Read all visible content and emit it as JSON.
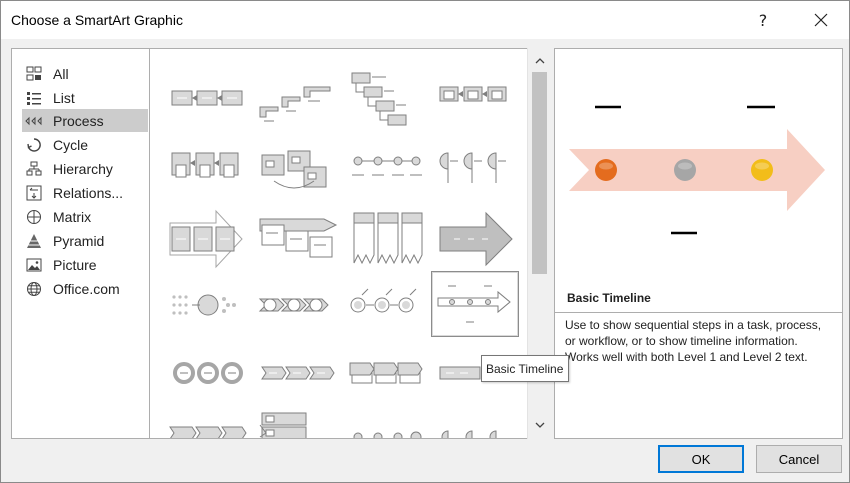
{
  "window": {
    "title": "Choose a SmartArt Graphic",
    "help": "?",
    "close": "✕"
  },
  "categories": [
    {
      "label": "All",
      "icon": "all-icon"
    },
    {
      "label": "List",
      "icon": "list-icon"
    },
    {
      "label": "Process",
      "icon": "process-icon",
      "selected": true
    },
    {
      "label": "Cycle",
      "icon": "cycle-icon"
    },
    {
      "label": "Hierarchy",
      "icon": "hierarchy-icon"
    },
    {
      "label": "Relations...",
      "icon": "relationship-icon"
    },
    {
      "label": "Matrix",
      "icon": "matrix-icon"
    },
    {
      "label": "Pyramid",
      "icon": "pyramid-icon"
    },
    {
      "label": "Picture",
      "icon": "picture-icon"
    },
    {
      "label": "Office.com",
      "icon": "globe-icon"
    }
  ],
  "preview": {
    "name": "Basic Timeline",
    "description": "Use to show sequential steps in a task, process, or workflow, or to show timeline information. Works well with both Level 1 and Level 2 text.",
    "dot_colors": [
      "#e46c1e",
      "#a6a6a6",
      "#f2bd1a"
    ],
    "arrow_color": "#f7cfc3"
  },
  "tooltip": "Basic Timeline",
  "buttons": {
    "ok": "OK",
    "cancel": "Cancel"
  },
  "scrollbar": {
    "up": "∧",
    "down": "∨"
  }
}
